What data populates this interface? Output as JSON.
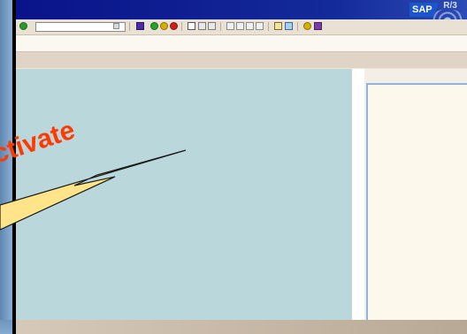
{
  "logo": {
    "sap": "SAP",
    "r3": "R/3"
  },
  "command_field": {
    "value": "",
    "placeholder": ""
  },
  "callout_text": "ctivate",
  "colors": {
    "title_bar": "#0a138a",
    "workarea": "#bad7dc",
    "callout_fill": "#ffe48a",
    "callout_text": "#ff3a00",
    "right_pane_border": "#8fb4de"
  },
  "toolbar_icons": [
    "enter-icon",
    "dropdown-icon",
    "save-icon",
    "back-icon",
    "exit-icon",
    "cancel-icon",
    "print-icon",
    "find-icon",
    "find-next-icon",
    "first-page-icon",
    "previous-page-icon",
    "next-page-icon",
    "last-page-icon",
    "create-session-icon",
    "shortcut-icon",
    "help-icon",
    "layout-icon"
  ]
}
